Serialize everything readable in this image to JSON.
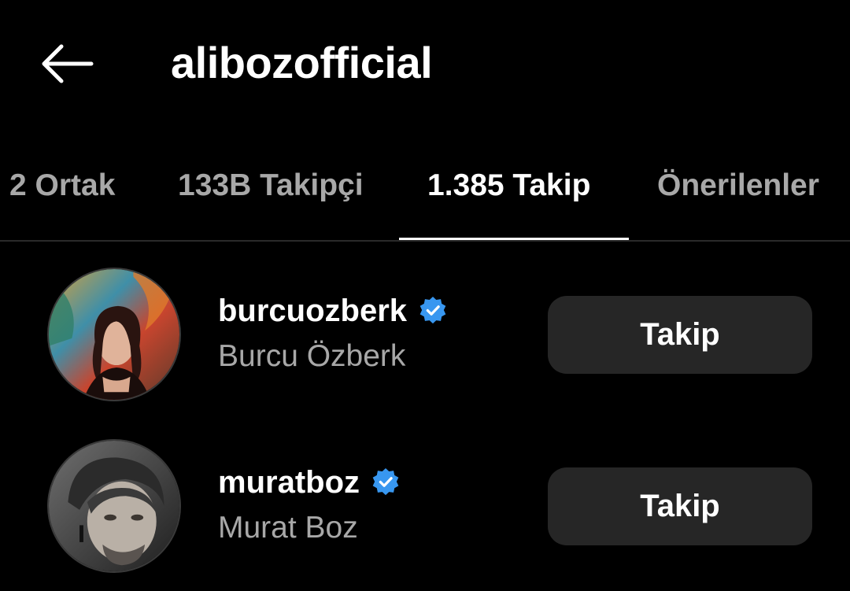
{
  "header": {
    "title": "alibozofficial",
    "back_icon": "arrow-left-icon"
  },
  "tabs": [
    {
      "label": "2 Ortak",
      "active": false
    },
    {
      "label": "133B Takipçi",
      "active": false
    },
    {
      "label": "1.385 Takip",
      "active": true
    },
    {
      "label": "Önerilenler",
      "active": false
    }
  ],
  "accounts": [
    {
      "username": "burcuozberk",
      "full_name": "Burcu Özberk",
      "verified": true,
      "button_label": "Takip"
    },
    {
      "username": "muratboz",
      "full_name": "Murat Boz",
      "verified": true,
      "button_label": "Takip"
    }
  ],
  "colors": {
    "background": "#000000",
    "text_primary": "#ffffff",
    "text_secondary": "#a8a8a8",
    "button_bg": "#262626",
    "verified_blue": "#3897f0"
  }
}
